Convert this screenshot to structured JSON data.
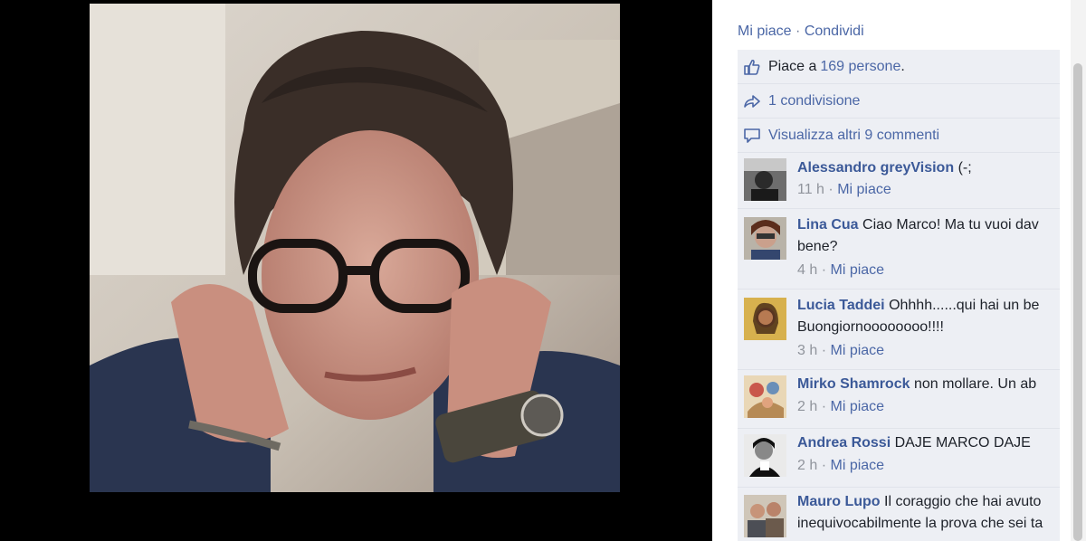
{
  "actions": {
    "like": "Mi piace",
    "separator": "·",
    "share": "Condividi"
  },
  "likes": {
    "prefix": "Piace a ",
    "count": "169 persone",
    "suffix": "."
  },
  "shares": {
    "text": "1 condivisione"
  },
  "more_comments": {
    "text": "Visualizza altri 9 commenti"
  },
  "comments": [
    {
      "author": "Alessandro greyVision",
      "text": "(-;",
      "text2": "",
      "time": "11 h",
      "like": "Mi piace"
    },
    {
      "author": "Lina Cua",
      "text": "Ciao Marco! Ma tu vuoi dav",
      "text2": "bene?",
      "time": "4 h",
      "like": "Mi piace"
    },
    {
      "author": "Lucia Taddei",
      "text": "Ohhhh......qui hai un be",
      "text2": "Buongiornoooooooo!!!!",
      "time": "3 h",
      "like": "Mi piace"
    },
    {
      "author": "Mirko Shamrock",
      "text": "non mollare. Un ab",
      "text2": "",
      "time": "2 h",
      "like": "Mi piace"
    },
    {
      "author": "Andrea Rossi",
      "text": "DAJE MARCO DAJE",
      "text2": "",
      "time": "2 h",
      "like": "Mi piace"
    },
    {
      "author": "Mauro Lupo",
      "text": "Il coraggio che hai avuto",
      "text2": "inequivocabilmente la prova che sei ta",
      "time": "",
      "like": ""
    }
  ],
  "meta_separator": "·",
  "icons": [
    "thumbs-up-icon",
    "share-arrow-icon",
    "comment-bubble-icon"
  ],
  "colors": {
    "link": "#4b67a6",
    "author": "#3b5998",
    "block_bg": "#edeff4",
    "meta": "#90949c"
  }
}
